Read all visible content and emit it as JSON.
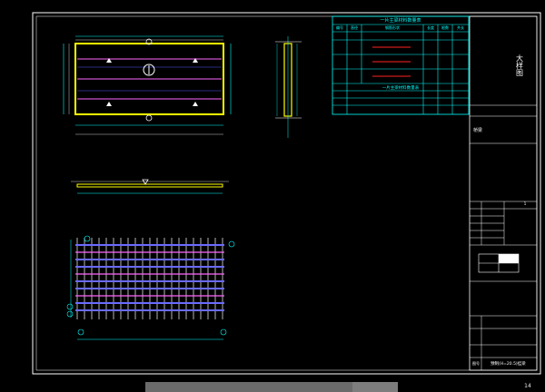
{
  "title_block": {
    "vertical_title": "大样图",
    "project_label": "桥梁",
    "drawing_name": "预制(H=20.5)挂梁",
    "bottom_label": "图号",
    "sheet_no": "1"
  },
  "tables": {
    "main_title": "一片主梁材料数量表",
    "sub_title": "一片主梁材料数量表",
    "headers": [
      "编号",
      "直径",
      "钢筋形状",
      "长度",
      "根数",
      "共长"
    ]
  },
  "status_bar": {
    "page": "14"
  }
}
